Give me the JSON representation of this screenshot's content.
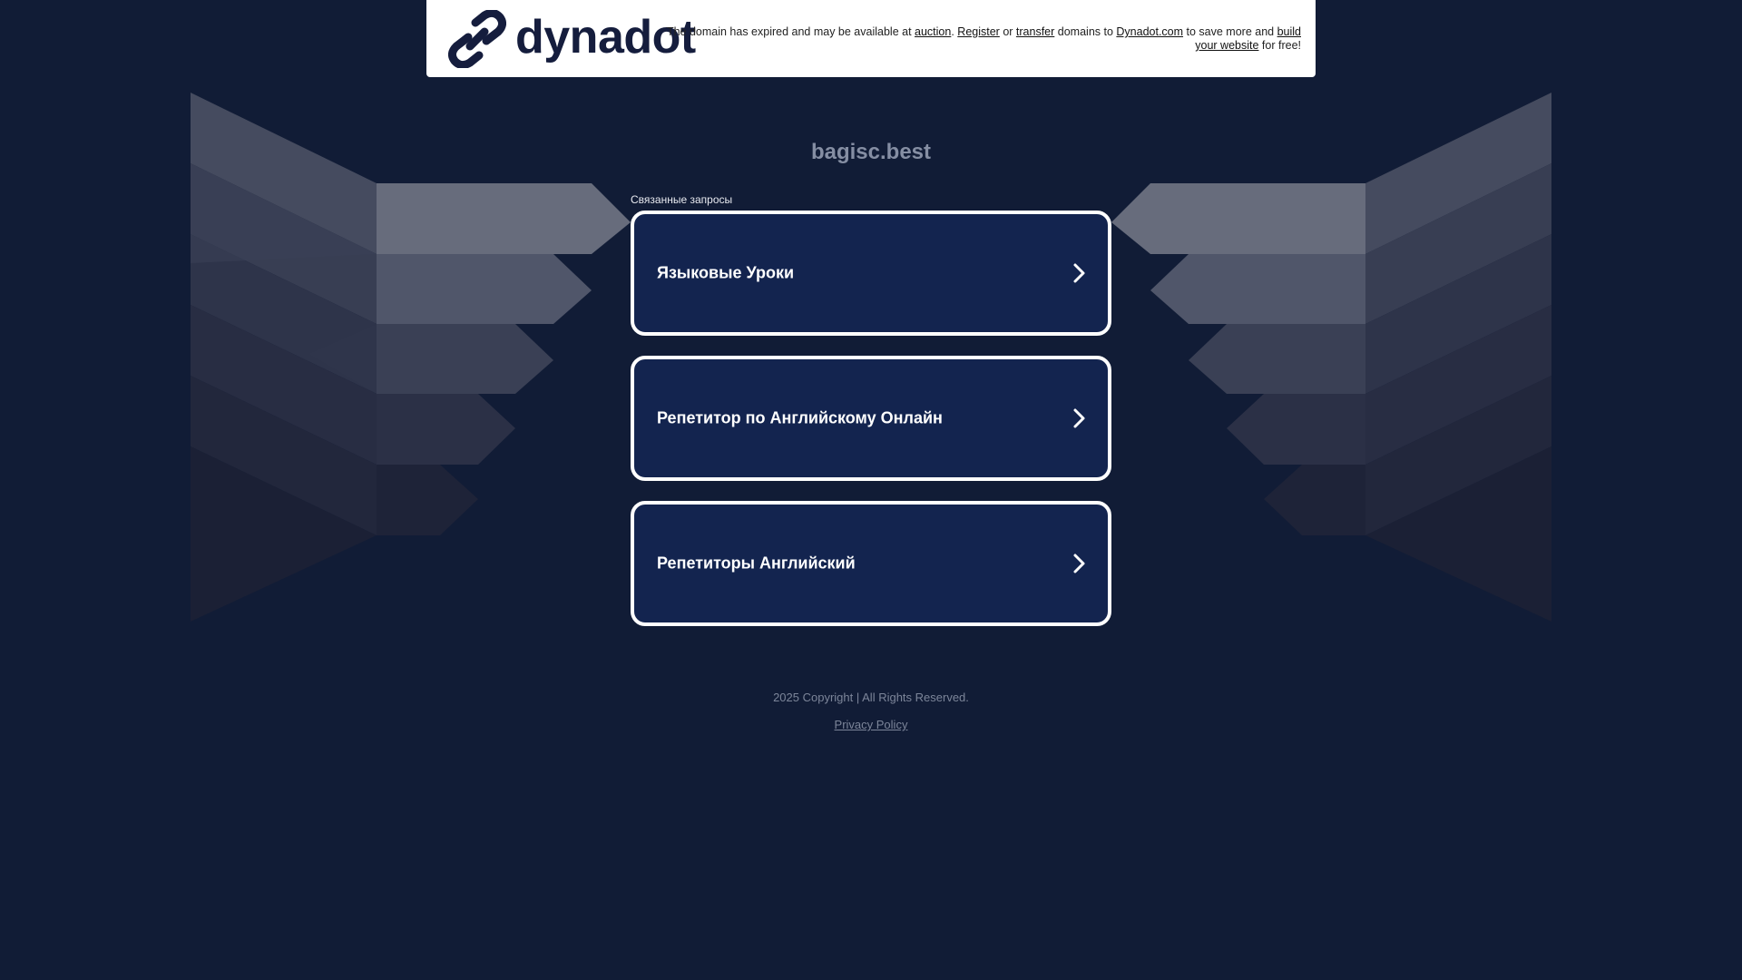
{
  "banner": {
    "logo_text": "dynadot",
    "text_before_auction": "The domain has expired and may be available at ",
    "auction_link": "auction",
    "text_after_auction": ". ",
    "register_link": "Register",
    "text_or": " or ",
    "transfer_link": "transfer",
    "text_domains_to": " domains to ",
    "dynadot_link": "Dynadot.com",
    "text_save_more": " to save more and ",
    "build_link": "build your website",
    "text_for_free": " for free!"
  },
  "domain_title": "bagisc.best",
  "related": {
    "label": "Связанные запросы",
    "items": [
      {
        "label": "Языковые Уроки"
      },
      {
        "label": "Репетитор по Английскому Онлайн"
      },
      {
        "label": "Репетиторы Английский"
      }
    ]
  },
  "footer": {
    "copyright": "2025 Copyright | All Rights Reserved.",
    "privacy": "Privacy Policy"
  },
  "colors": {
    "page_background": "#111c36",
    "link_box_background": "#13244f",
    "link_box_border": "#ffffff",
    "logo_color": "#151d3d",
    "title_color": "#858ea3"
  },
  "icons": [
    "dynadot-logo-icon",
    "chevron-right-icon"
  ]
}
